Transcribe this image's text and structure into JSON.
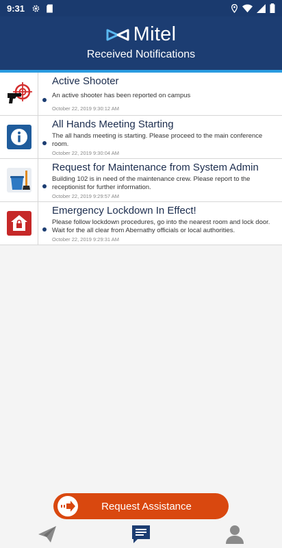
{
  "status_bar": {
    "time": "9:31",
    "icons": [
      "gear-icon",
      "sd-card-icon",
      "location-icon",
      "wifi-icon",
      "signal-icon",
      "battery-icon"
    ]
  },
  "header": {
    "brand": "Mitel",
    "subtitle": "Received Notifications"
  },
  "notifications": [
    {
      "icon": "target-gun-icon",
      "title": "Active Shooter",
      "message": "An active shooter has been reported on campus",
      "timestamp": "October 22, 2019 9:30:12 AM"
    },
    {
      "icon": "info-icon",
      "title": "All Hands Meeting Starting",
      "message": "The all hands meeting is starting. Please proceed to the main conference room.",
      "timestamp": "October 22, 2019 9:30:04 AM"
    },
    {
      "icon": "maintenance-bucket-icon",
      "title": "Request for Maintenance from System Admin",
      "message": "Building 102 is in need of the maintenance crew. Please report to the receptionist for further information.",
      "timestamp": "October 22, 2019 9:29:57 AM"
    },
    {
      "icon": "lockdown-house-icon",
      "title": "Emergency Lockdown In Effect!",
      "message": "Please follow lockdown procedures, go into the nearest room and lock door. Wait for the all clear from Abernathy officials or local authorities.",
      "timestamp": "October 22, 2019 9:29:31 AM"
    }
  ],
  "cta": {
    "label": "Request Assistance"
  },
  "bottom_nav": [
    {
      "icon": "send-icon",
      "active": false
    },
    {
      "icon": "messages-icon",
      "active": true
    },
    {
      "icon": "profile-icon",
      "active": false
    }
  ],
  "colors": {
    "header": "#1c3d72",
    "accent_stripe": "#2a9be0",
    "cta": "#d9480f"
  }
}
